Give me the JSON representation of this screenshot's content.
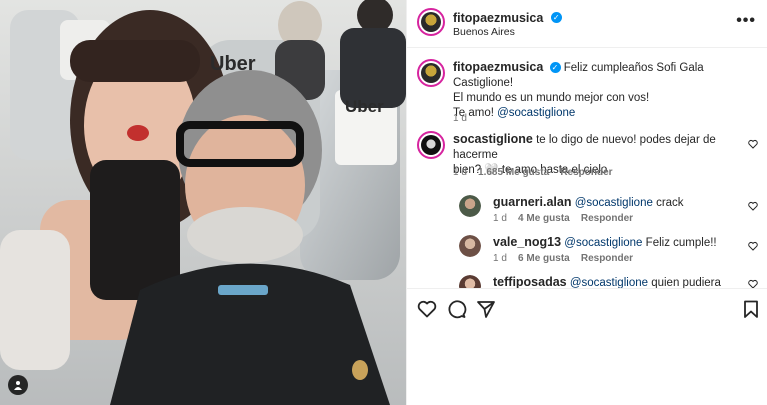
{
  "post": {
    "author": "fitopaezmusica",
    "location": "Buenos Aires",
    "caption_line1": "Feliz cumpleaños Sofi Gala Castiglione!",
    "caption_line2": "El mundo es un mundo mejor con vos!",
    "caption_line3_text": "Te amo! ",
    "caption_line3_mention": "@socastiglione",
    "caption_time": "1 d"
  },
  "photo": {
    "seat_logo_left": "Uber",
    "seat_logo_right": "Uber"
  },
  "comments": [
    {
      "user": "socastiglione",
      "line1": "te lo digo de nuevo! podes dejar de hacerme",
      "line2": "bien? 🤍 te amo hasta el cielo",
      "time": "1 d",
      "likes": "1.685 Me gusta",
      "reply": "Responder"
    }
  ],
  "replies": [
    {
      "user": "guarneri.alan",
      "mention": "@socastiglione",
      "text": " crack",
      "time": "1 d",
      "likes": "4 Me gusta",
      "reply": "Responder"
    },
    {
      "user": "vale_nog13",
      "mention": "@socastiglione",
      "text": " Feliz cumple!!",
      "time": "1 d",
      "likes": "6 Me gusta",
      "reply": "Responder"
    },
    {
      "user": "teffiposadas",
      "mention": "@socastiglione",
      "text": " quien pudiera tener el"
    }
  ],
  "icons": [
    "more-icon",
    "verified-icon",
    "heart-icon",
    "comment-icon",
    "share-icon",
    "bookmark-icon",
    "user-tag-icon"
  ],
  "colors": {
    "link": "#00376b",
    "verified": "#0095f6",
    "meta": "#737373",
    "story_ring": "#d6249f"
  }
}
